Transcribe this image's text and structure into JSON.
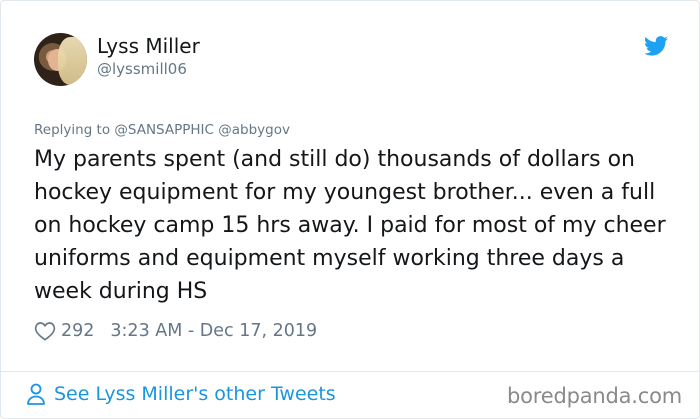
{
  "tweet": {
    "author_name": "Lyss Miller",
    "author_handle": "@lyssmill06",
    "reply_prefix": "Replying to",
    "reply_mentions": "@SANSAPPHIC @abbygov",
    "text": "My parents spent (and still do) thousands of dollars on hockey equipment for my youngest brother... even a full on hockey camp 15 hrs away. I paid for most of my cheer uniforms and equipment myself working three days a week during HS",
    "like_count": "292",
    "timestamp": "3:23 AM - Dec 17, 2019"
  },
  "footer": {
    "see_more_label": "See Lyss Miller's other Tweets",
    "watermark": "boredpanda.com"
  },
  "icons": {
    "brand": "twitter-bird-icon",
    "like": "heart-outline-icon",
    "profile": "person-icon"
  },
  "colors": {
    "twitter_blue": "#1DA1F2",
    "link_blue": "#1B95E0",
    "secondary_text": "#657786",
    "primary_text": "#14171A"
  }
}
